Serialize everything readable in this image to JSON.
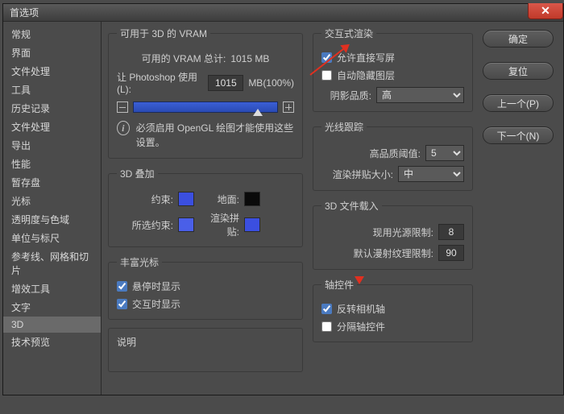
{
  "window": {
    "title": "首选项"
  },
  "sidebar": {
    "items": [
      "常规",
      "界面",
      "文件处理",
      "工具",
      "历史记录",
      "文件处理",
      "导出",
      "性能",
      "暂存盘",
      "光标",
      "透明度与色域",
      "单位与标尺",
      "参考线、网格和切片",
      "增效工具",
      "文字",
      "3D",
      "技术预览"
    ],
    "selectedIndex": 15
  },
  "vram": {
    "legend": "可用于 3D 的 VRAM",
    "totalLabel": "可用的 VRAM 总计:",
    "totalValue": "1015 MB",
    "letLabel": "让 Photoshop 使用(L):",
    "value": "1015",
    "unit": "MB(100%)",
    "info": "必须启用 OpenGL 绘图才能使用这些设置。"
  },
  "overlay": {
    "legend": "3D 叠加",
    "c1": "约束:",
    "c2": "地面:",
    "c3": "所选约束:",
    "c4": "渲染拼贴:"
  },
  "rich": {
    "legend": "丰富光标",
    "hover": "悬停时显示",
    "interact": "交互时显示"
  },
  "render": {
    "legend": "交互式渲染",
    "direct": "允许直接写屏",
    "autohide": "自动隐藏图层",
    "shadowLabel": "阴影品质:",
    "shadowValue": "高"
  },
  "ray": {
    "legend": "光线跟踪",
    "thLabel": "高品质阈值:",
    "thValue": "5",
    "tileLabel": "渲染拼贴大小:",
    "tileValue": "中"
  },
  "load": {
    "legend": "3D 文件载入",
    "lightLabel": "现用光源限制:",
    "lightValue": "8",
    "diffLabel": "默认漫射纹理限制:",
    "diffValue": "90"
  },
  "axis": {
    "legend": "轴控件",
    "invert": "反转相机轴",
    "sep": "分隔轴控件"
  },
  "desc": {
    "legend": "说明"
  },
  "buttons": {
    "ok": "确定",
    "reset": "复位",
    "prev": "上一个(P)",
    "next": "下一个(N)"
  }
}
